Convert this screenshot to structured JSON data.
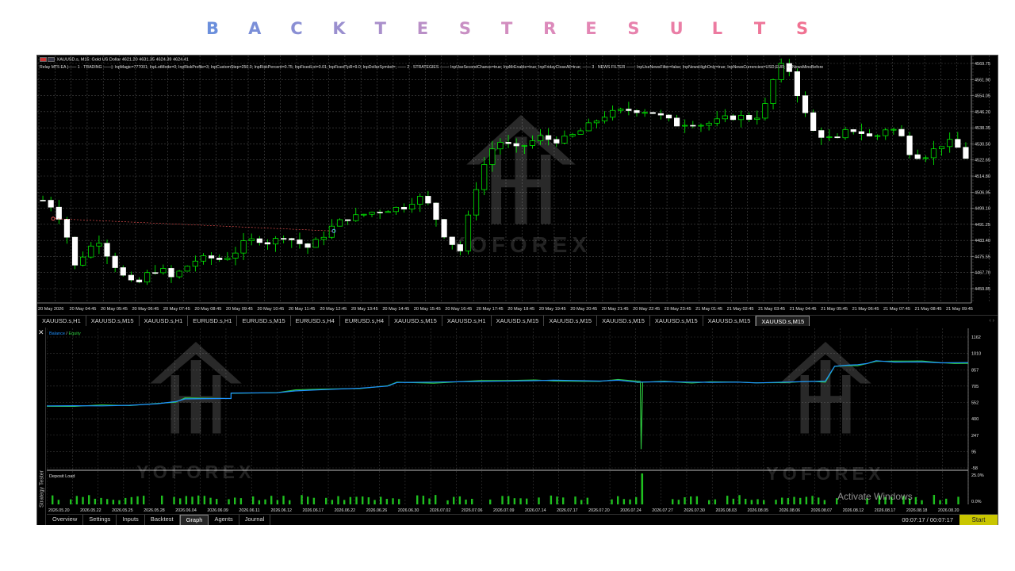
{
  "page_title_letters": [
    "B",
    "A",
    "C",
    "K",
    "T",
    "E",
    "S",
    "T",
    "R",
    "E",
    "S",
    "U",
    "L",
    "T",
    "S"
  ],
  "page_title_colors": [
    "#6b8fdc",
    "#7b8fd8",
    "#8a8fd4",
    "#9a8fcf",
    "#a98fcb",
    "#b98fc7",
    "#c88fc3",
    "#d28dbf",
    "#dc8abb",
    "#e386b4",
    "#e782ad",
    "#ea7ea6",
    "#ec7aa0",
    "#ee7699",
    "#f07292"
  ],
  "chart": {
    "symbol_line": "XAUUSD.s, M15:  Gold US Dollar  4621.20 4631.35 4624.39 4624.41",
    "ea_line": "Relay MT5 EA   |—— 1 · TRADING ——|: InpMagic=777001; InpLotMode=0; InpRiskProfile=3; InpCustomStep=250.0; InpRiskPercent=0.75; InpFixedLot=0.01; InpFixedTpR=9.0; InpDollarSymbol=; —— 2 · STRATEGIES ——: InpUseSecondChance=true; InpMrEnable=true; InpFridayCloseAll=true; —— 3 · NEWS FILTER ——: InpUseNewsFilter=false; InpNewsHighOnly=true; InpNewsCurrencies=USD,EUR; InpNewsMinsBefore",
    "price_labels": [
      "4569.75",
      "4561.90",
      "4554.05",
      "4546.20",
      "4538.35",
      "4530.50",
      "4522.65",
      "4514.80",
      "4506.95",
      "4499.10",
      "4491.25",
      "4483.40",
      "4475.55",
      "4467.70",
      "4459.85"
    ],
    "time_labels": [
      "20 May 2026",
      "20 May 04:45",
      "20 May 05:45",
      "20 May 06:45",
      "20 May 07:45",
      "20 May 08:45",
      "20 May 09:45",
      "20 May 10:45",
      "20 May 11:45",
      "20 May 12:45",
      "20 May 13:45",
      "20 May 14:45",
      "20 May 15:45",
      "20 May 16:45",
      "20 May 17:45",
      "20 May 18:45",
      "20 May 19:45",
      "20 May 20:45",
      "20 May 21:45",
      "20 May 22:45",
      "20 May 23:45",
      "21 May 01:45",
      "21 May 02:45",
      "21 May 03:45",
      "21 May 04:45",
      "21 May 05:45",
      "21 May 06:45",
      "21 May 07:45",
      "21 May 08:45",
      "21 May 09:45"
    ],
    "bull_color": "#00ff00",
    "bear_color": "#ffffff",
    "current_price": 4524.41
  },
  "symbol_tabs": [
    "XAUUSD.s,H1",
    "XAUUSD.s,M15",
    "XAUUSD.s,H1",
    "EURUSD.s,H1",
    "EURUSD.s,M15",
    "EURUSD.s,H4",
    "EURUSD.s,H4",
    "XAUUSD.s,M15",
    "XAUUSD.s,H1",
    "XAUUSD.s,M15",
    "XAUUSD.s,M15",
    "XAUUSD.s,M15",
    "XAUUSD.s,M15",
    "XAUUSD.s,M15",
    "XAUUSD.s,M15"
  ],
  "symbol_tabs_active": 14,
  "tester": {
    "side_title": "Strategy Tester",
    "legend_balance": "Balance",
    "legend_sep": " / ",
    "legend_equity": "Equity",
    "y_labels": [
      "1162",
      "1010",
      "857",
      "705",
      "552",
      "400",
      "247",
      "95",
      "-58"
    ],
    "deposit_label": "Deposit Load",
    "deposit_y_labels": [
      "25.0%",
      "0.0%"
    ],
    "date_labels": [
      "2026.05.20",
      "2026.05.22",
      "2026.05.25",
      "2026.05.28",
      "2026.06.04",
      "2026.06.09",
      "2026.06.11",
      "2026.06.12",
      "2026.06.17",
      "2026.06.22",
      "2026.06.26",
      "2026.06.30",
      "2026.07.02",
      "2026.07.06",
      "2026.07.09",
      "2026.07.14",
      "2026.07.17",
      "2026.07.20",
      "2026.07.24",
      "2026.07.27",
      "2026.07.30",
      "2026.08.03",
      "2026.08.05",
      "2026.08.06",
      "2026.08.07",
      "2026.08.12",
      "2026.08.17",
      "2026.08.18",
      "2026.08.20"
    ],
    "balance_color": "#1e90ff",
    "equity_color": "#2ecc40",
    "tabs": [
      "Overview",
      "Settings",
      "Inputs",
      "Backtest",
      "Graph",
      "Agents",
      "Journal"
    ],
    "active_tab": 4,
    "timer": "00:07:17 / 00:07:17",
    "start_label": "Start"
  },
  "watermark_text": "YOFOREX",
  "activate_text": "Activate Windows"
}
